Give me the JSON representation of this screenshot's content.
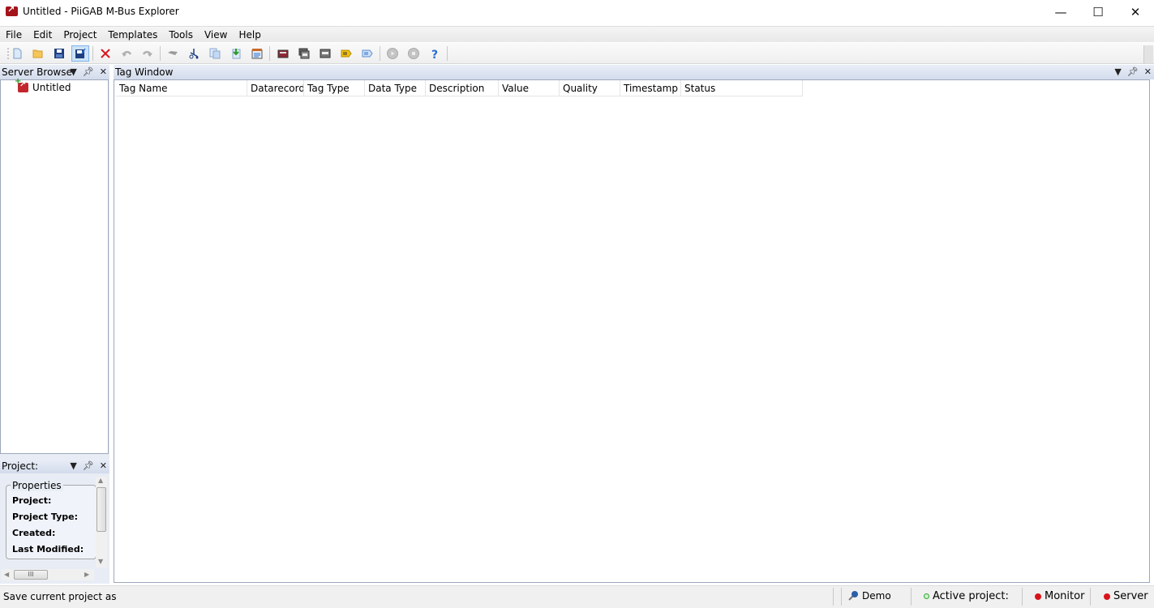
{
  "window": {
    "title": "Untitled - PiiGAB M-Bus Explorer",
    "app_icon": "piigab-logo-icon",
    "controls": {
      "minimize": "—",
      "maximize": "☐",
      "close": "✕"
    }
  },
  "menu": [
    "File",
    "Edit",
    "Project",
    "Templates",
    "Tools",
    "View",
    "Help"
  ],
  "toolbar": {
    "buttons": [
      {
        "name": "new-file",
        "icon": "new-document-icon"
      },
      {
        "name": "open",
        "icon": "open-folder-icon"
      },
      {
        "name": "save",
        "icon": "save-disk-icon"
      },
      {
        "name": "save-as",
        "icon": "save-as-disk-icon",
        "active": true
      },
      {
        "name": "delete",
        "icon": "red-x-icon"
      },
      {
        "name": "undo",
        "icon": "undo-icon"
      },
      {
        "name": "redo",
        "icon": "redo-icon"
      },
      {
        "name": "eraser",
        "icon": "eraser-icon"
      },
      {
        "name": "cut",
        "icon": "scissors-icon"
      },
      {
        "name": "copy",
        "icon": "copy-icon"
      },
      {
        "name": "paste",
        "icon": "paste-icon"
      },
      {
        "name": "properties",
        "icon": "properties-list-icon"
      },
      {
        "name": "device-red",
        "icon": "device-icon"
      },
      {
        "name": "device-stack",
        "icon": "device-stack-icon"
      },
      {
        "name": "device-gray",
        "icon": "device-window-icon"
      },
      {
        "name": "tag-yellow",
        "icon": "tag-yellow-icon"
      },
      {
        "name": "tag-blue",
        "icon": "tag-blue-icon"
      },
      {
        "name": "start",
        "icon": "play-icon"
      },
      {
        "name": "stop",
        "icon": "stop-icon"
      },
      {
        "name": "help",
        "icon": "help-question-icon"
      }
    ]
  },
  "server_browser": {
    "title": "Server Browser",
    "tree": [
      {
        "label": "Untitled",
        "icon": "project-icon"
      }
    ]
  },
  "project_panel": {
    "title": "Project:",
    "group_title": "Properties",
    "properties": [
      {
        "label": "Project:",
        "value": ""
      },
      {
        "label": "Project Type:",
        "value": ""
      },
      {
        "label": "Created:",
        "value": ""
      },
      {
        "label": "Last Modified:",
        "value": ""
      }
    ]
  },
  "tag_window": {
    "title": "Tag Window",
    "columns": [
      "Tag Name",
      "Datarecord",
      "Tag Type",
      "Data Type",
      "Description",
      "Value",
      "Quality",
      "Timestamp",
      "Status"
    ],
    "rows": []
  },
  "statusbar": {
    "message": "Save current project as",
    "mode": "Demo",
    "active_project": "Active project:",
    "monitor": "Monitor",
    "server": "Server",
    "colors": {
      "active": "#5cc85c",
      "monitor": "#d8141a",
      "server": "#d8141a"
    }
  }
}
